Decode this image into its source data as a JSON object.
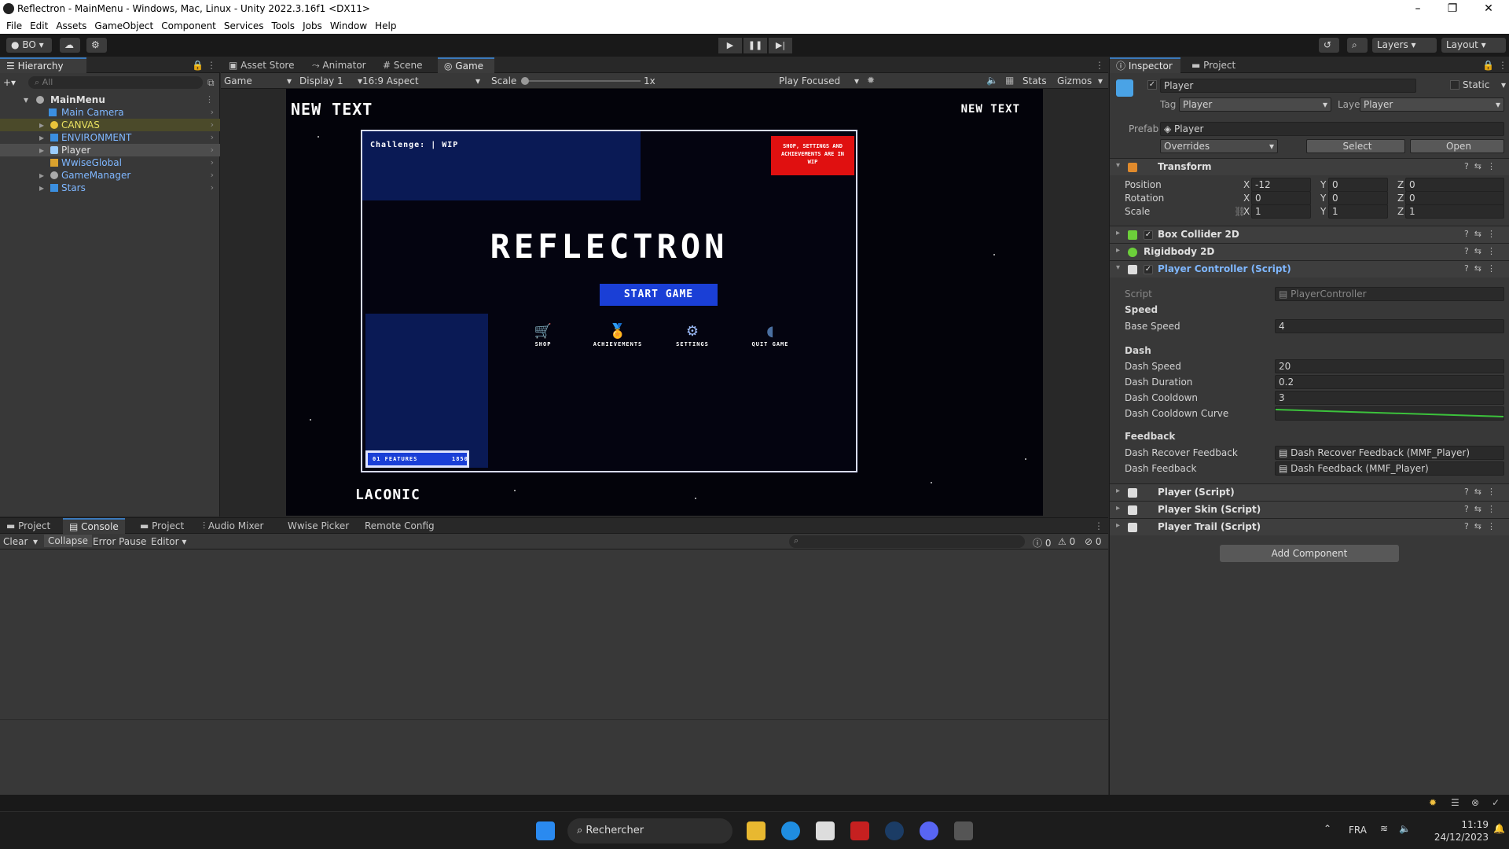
{
  "window": {
    "title": "Reflectron - MainMenu - Windows, Mac, Linux - Unity 2022.3.16f1 <DX11>",
    "controls": [
      "–",
      "❐",
      "✕"
    ]
  },
  "menu": [
    "File",
    "Edit",
    "Assets",
    "GameObject",
    "Component",
    "Services",
    "Tools",
    "Jobs",
    "Window",
    "Help"
  ],
  "toolbar": {
    "account_label": "BO",
    "layers_label": "Layers",
    "layout_label": "Layout"
  },
  "hierarchy": {
    "tab_label": "Hierarchy",
    "search_placeholder": "All",
    "scene": "MainMenu",
    "items": [
      {
        "label": "Main Camera",
        "color": "#7fb7ff"
      },
      {
        "label": "CANVAS",
        "color": "#e8e060"
      },
      {
        "label": "ENVIRONMENT",
        "color": "#7fb7ff"
      },
      {
        "label": "Player",
        "color": "#e0e0e0"
      },
      {
        "label": "WwiseGlobal",
        "color": "#7fb7ff"
      },
      {
        "label": "GameManager",
        "color": "#7fb7ff"
      },
      {
        "label": "Stars",
        "color": "#7fb7ff"
      }
    ]
  },
  "center_tabs": [
    {
      "label": "Asset Store"
    },
    {
      "label": "Animator"
    },
    {
      "label": "Scene"
    },
    {
      "label": "Game"
    }
  ],
  "game_toolbar": {
    "mode": "Game",
    "display": "Display 1",
    "aspect": "16:9 Aspect",
    "scale_label": "Scale",
    "scale_value": "1x",
    "play_focus": "Play Focused",
    "stats": "Stats",
    "gizmos": "Gizmos"
  },
  "game": {
    "top_left_text": "NEW TEXT",
    "top_right_text": "NEW TEXT",
    "challenge_text": "Challenge: | WIP",
    "warning_text": "SHOP, SETTINGS AND ACHIEVEMENTS ARE IN WIP",
    "title": "REFLECTRON",
    "start_button": "START GAME",
    "menu_items": [
      "SHOP",
      "ACHIEVEMENTS",
      "SETTINGS",
      "QUIT GAME"
    ],
    "features_left": "01 FEATURES",
    "features_right": "1850",
    "bottom_text": "LACONIC"
  },
  "inspector": {
    "tabs": [
      "Inspector",
      "Project"
    ],
    "object_name": "Player",
    "static_label": "Static",
    "tag_label": "Tag",
    "tag_value": "Player",
    "layer_label": "Layer",
    "layer_value": "Player",
    "prefab_label": "Prefab",
    "prefab_value": "Player",
    "overrides": "Overrides",
    "select": "Select",
    "open": "Open",
    "transform": {
      "title": "Transform",
      "position_label": "Position",
      "rotation_label": "Rotation",
      "scale_label": "Scale",
      "position": {
        "x": "-12",
        "y": "0",
        "z": "0"
      },
      "rotation": {
        "x": "0",
        "y": "0",
        "z": "0"
      },
      "scale": {
        "x": "1",
        "y": "1",
        "z": "1"
      }
    },
    "components": [
      "Box Collider 2D",
      "Rigidbody 2D",
      "Player Controller (Script)"
    ],
    "script_label": "Script",
    "script_value": "PlayerController",
    "speed_section": "Speed",
    "base_speed_label": "Base Speed",
    "base_speed": "4",
    "dash_section": "Dash",
    "dash_speed_label": "Dash Speed",
    "dash_speed": "20",
    "dash_duration_label": "Dash Duration",
    "dash_duration": "0.2",
    "dash_cooldown_label": "Dash Cooldown",
    "dash_cooldown": "3",
    "dash_curve_label": "Dash Cooldown Curve",
    "feedback_section": "Feedback",
    "recover_label": "Dash Recover Feedback",
    "recover_value": "Dash Recover Feedback (MMF_Player)",
    "dash_fb_label": "Dash Feedback",
    "dash_fb_value": "Dash Feedback (MMF_Player)",
    "more_components": [
      "Player (Script)",
      "Player Skin (Script)",
      "Player Trail (Script)"
    ],
    "add_component": "Add Component"
  },
  "console": {
    "tabs": [
      "Project",
      "Console",
      "Project",
      "Audio Mixer",
      "Wwise Picker",
      "Remote Config"
    ],
    "clear": "Clear",
    "collapse": "Collapse",
    "error_pause": "Error Pause",
    "editor": "Editor",
    "counts": [
      "0",
      "0",
      "0"
    ]
  },
  "taskbar": {
    "search": "Rechercher",
    "lang": "FRA",
    "time": "11:19",
    "date": "24/12/2023"
  }
}
